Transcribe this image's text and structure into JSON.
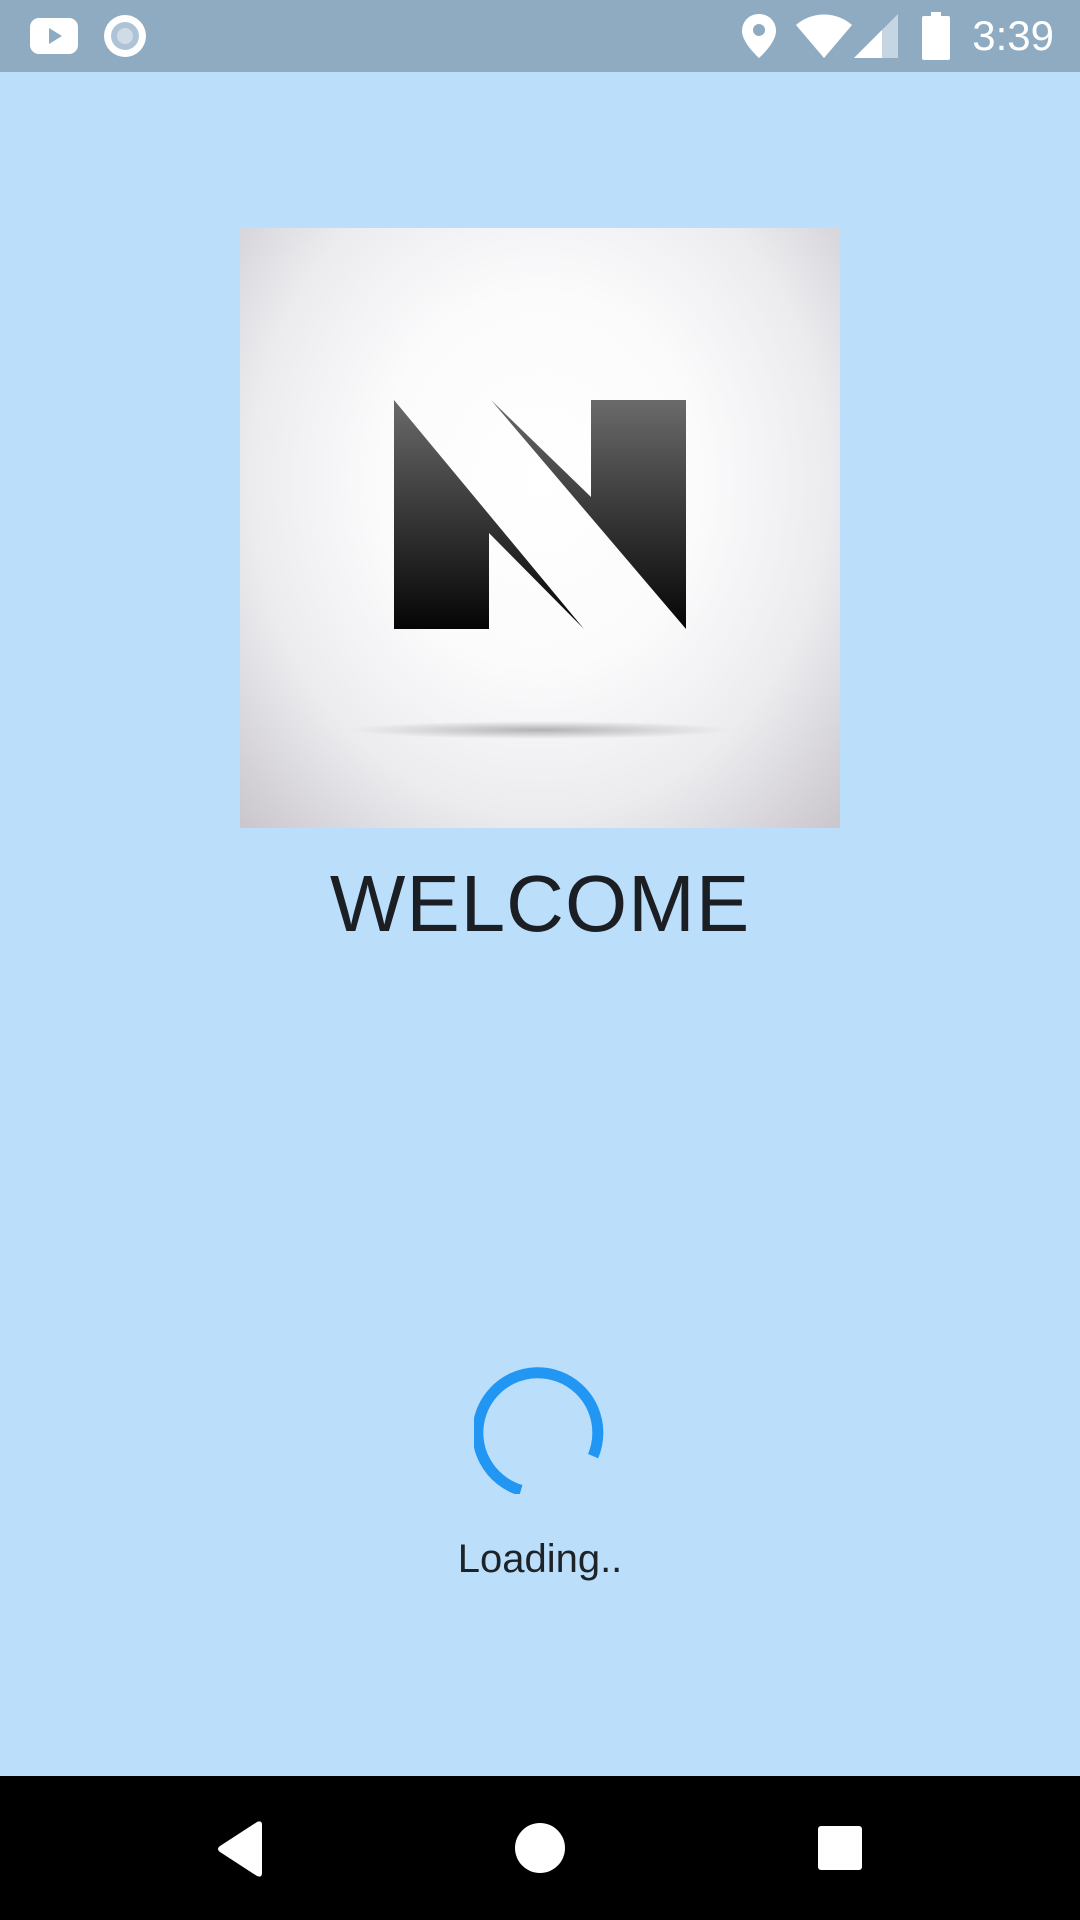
{
  "status_bar": {
    "time": "3:39",
    "left_icons": [
      "youtube-icon",
      "record-icon"
    ],
    "right_icons": [
      "location-icon",
      "wifi-icon",
      "signal-icon",
      "battery-icon"
    ]
  },
  "splash": {
    "logo": "n-letter-logo",
    "title": "WELCOME",
    "loading_text": "Loading.."
  },
  "colors": {
    "background": "#bbdefb",
    "status_bar": "#8eabc2",
    "spinner": "#2196f3",
    "text": "#1b1f24",
    "nav_bar": "#000000"
  },
  "nav_bar": {
    "buttons": [
      "back-icon",
      "home-icon",
      "recents-icon"
    ]
  }
}
